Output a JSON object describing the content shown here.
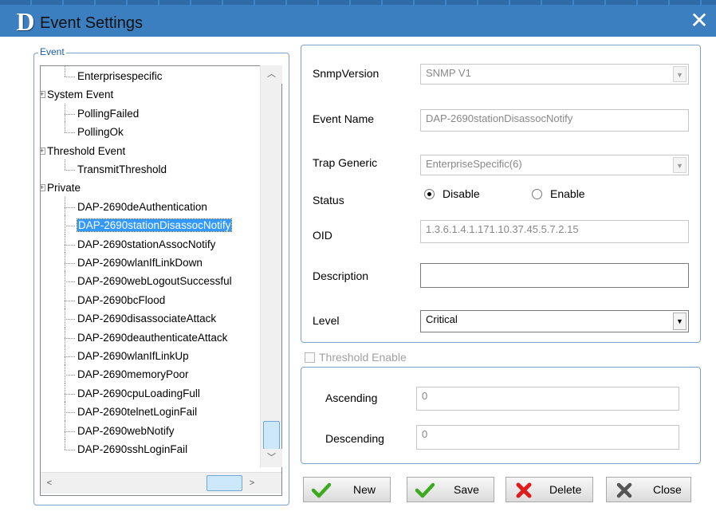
{
  "window": {
    "title": "Event Settings",
    "logo": "D",
    "close_glyph": "✕"
  },
  "event_group": {
    "legend": "Event"
  },
  "tree": {
    "items": [
      {
        "label": "Enterprisespecific",
        "level": 2,
        "last": true
      },
      {
        "label": "System Event",
        "level": 1,
        "expander": "+"
      },
      {
        "label": "PollingFailed",
        "level": 2
      },
      {
        "label": "PollingOk",
        "level": 2,
        "last": true
      },
      {
        "label": "Threshold Event",
        "level": 1,
        "expander": "+"
      },
      {
        "label": "TransmitThreshold",
        "level": 2,
        "last": true
      },
      {
        "label": "Private",
        "level": 1,
        "expander": "+"
      },
      {
        "label": "DAP-2690deAuthentication",
        "level": 2
      },
      {
        "label": "DAP-2690stationDisassocNotify",
        "level": 2,
        "selected": true
      },
      {
        "label": "DAP-2690stationAssocNotify",
        "level": 2
      },
      {
        "label": "DAP-2690wlanIfLinkDown",
        "level": 2
      },
      {
        "label": "DAP-2690webLogoutSuccessful",
        "level": 2
      },
      {
        "label": "DAP-2690bcFlood",
        "level": 2
      },
      {
        "label": "DAP-2690disassociateAttack",
        "level": 2
      },
      {
        "label": "DAP-2690deauthenticateAttack",
        "level": 2
      },
      {
        "label": "DAP-2690wlanIfLinkUp",
        "level": 2
      },
      {
        "label": "DAP-2690memoryPoor",
        "level": 2
      },
      {
        "label": "DAP-2690cpuLoadingFull",
        "level": 2
      },
      {
        "label": "DAP-2690telnetLoginFail",
        "level": 2
      },
      {
        "label": "DAP-2690webNotify",
        "level": 2
      },
      {
        "label": "DAP-2690sshLoginFail",
        "level": 2,
        "last": true
      }
    ]
  },
  "form": {
    "snmp_version": {
      "label": "SnmpVersion",
      "value": "SNMP V1"
    },
    "event_name": {
      "label": "Event Name",
      "value": "DAP-2690stationDisassocNotify"
    },
    "trap_generic": {
      "label": "Trap Generic",
      "value": "EnterpriseSpecific(6)"
    },
    "status": {
      "label": "Status",
      "options": [
        "Disable",
        "Enable"
      ],
      "selected": "Disable"
    },
    "oid": {
      "label": "OID",
      "value": "1.3.6.1.4.1.171.10.37.45.5.7.2.15"
    },
    "description": {
      "label": "Description",
      "value": ""
    },
    "level": {
      "label": "Level",
      "value": "Critical"
    }
  },
  "threshold": {
    "enable_label": "Threshold Enable",
    "ascending": {
      "label": "Ascending",
      "value": "0"
    },
    "descending": {
      "label": "Descending",
      "value": "0"
    }
  },
  "buttons": {
    "new": "New",
    "save": "Save",
    "delete": "Delete",
    "close": "Close"
  },
  "colors": {
    "titlebar": "#3c7fc0",
    "group_border": "#7da2ce",
    "selection": "#3399ff",
    "check_green": "#3caa1e",
    "delete_red": "#e01b1b"
  }
}
